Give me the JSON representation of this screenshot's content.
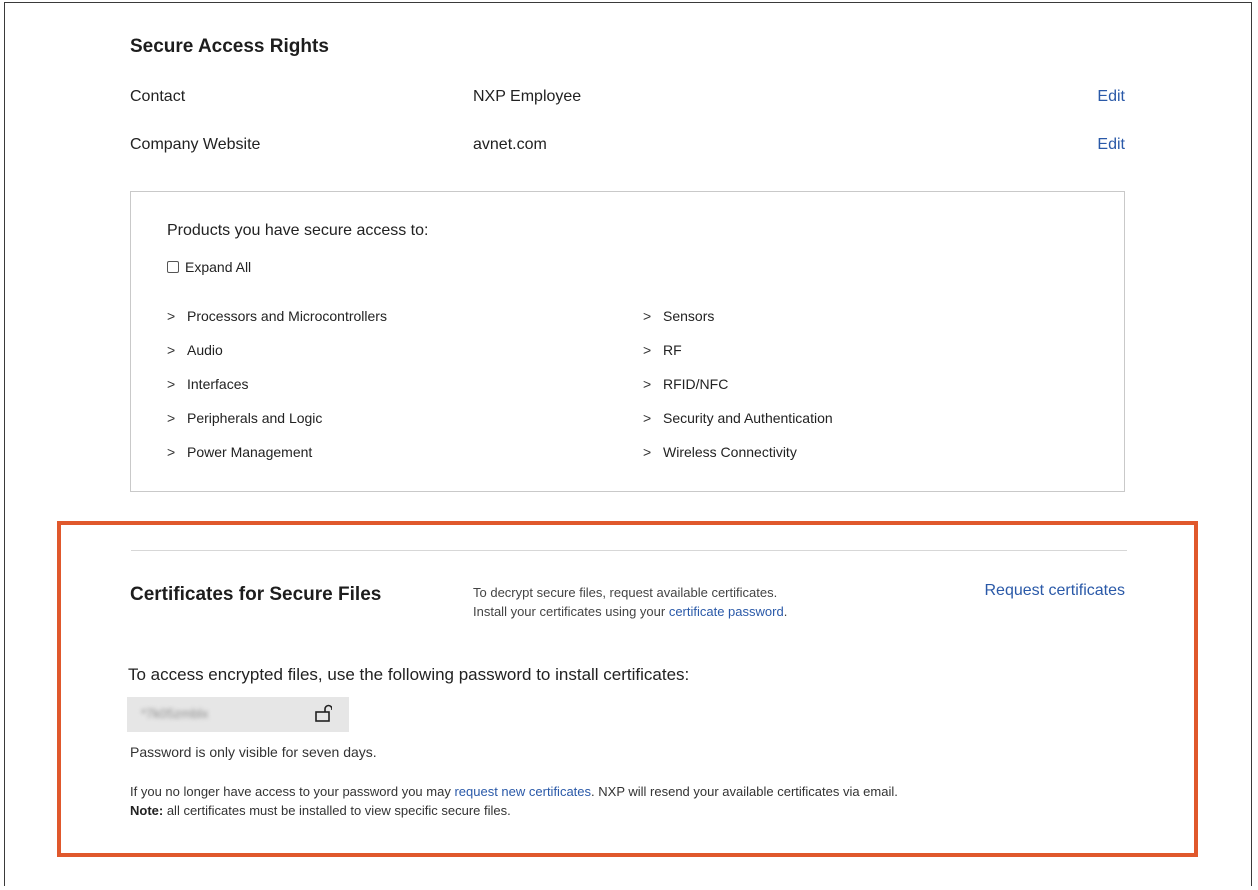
{
  "secure_access": {
    "title": "Secure Access Rights",
    "rows": [
      {
        "label": "Contact",
        "value": "NXP Employee",
        "action": "Edit"
      },
      {
        "label": "Company Website",
        "value": "avnet.com",
        "action": "Edit"
      }
    ]
  },
  "products": {
    "title": "Products you have secure access to:",
    "expand_all_label": "Expand All",
    "expand_all_checked": false,
    "left_categories": [
      "Processors and Microcontrollers",
      "Audio",
      "Interfaces",
      "Peripherals and Logic",
      "Power Management"
    ],
    "right_categories": [
      "Sensors",
      "RF",
      "RFID/NFC",
      "Security and Authentication",
      "Wireless Connectivity"
    ]
  },
  "certificates": {
    "title": "Certificates for Secure Files",
    "desc_line1": "To decrypt secure files, request available certificates.",
    "desc_line2_prefix": "Install your certificates using your ",
    "desc_line2_link": "certificate password",
    "desc_line2_suffix": ".",
    "request_label": "Request certificates",
    "access_text": "To access encrypted files, use the following password to install certificates:",
    "password_masked": "*7k05zmblx",
    "password_note": "Password is only visible for seven days.",
    "footer_prefix": "If you no longer have access to your password you may ",
    "footer_link": "request new certificates",
    "footer_suffix": ". NXP will resend your available certificates via email.",
    "note_label": "Note:",
    "note_text": " all certificates must be installed to view specific secure files."
  },
  "icons": {
    "checkbox": "checkbox-icon",
    "chevron": "chevron-right-icon",
    "lock": "unlock-icon"
  },
  "colors": {
    "link": "#2a59a8",
    "highlight_border": "#e0582c"
  }
}
